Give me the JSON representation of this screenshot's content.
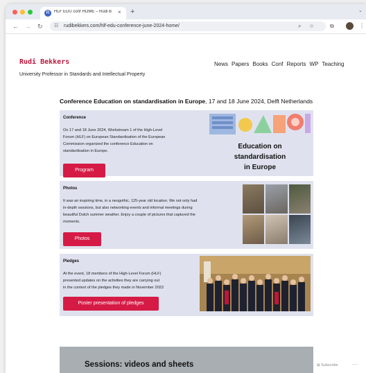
{
  "browser": {
    "tab_title": "HLF EDU conf HOME – Rudi B",
    "tab_favicon": "R",
    "tab_close": "×",
    "new_tab": "+",
    "tab_menu": "⌄",
    "url": "rudibekkers.com/hlf-edu-conference-june-2024-home/"
  },
  "site": {
    "brand": "Rudi Bekkers",
    "tagline": "University Professor in Standards and Intellectual Property",
    "nav": [
      "News",
      "Papers",
      "Books",
      "Conf",
      "Reports",
      "WP",
      "Teaching"
    ]
  },
  "main": {
    "title_bold": "Conference Education on standardisation in Europe",
    "title_rest": ", 17 and 18 June 2024, Delft Netherlands",
    "conference": {
      "heading": "Conference",
      "lines": [
        "On 17 and 18 June 2024, Workstream 1 of the High-Level",
        "Forum (HLF) on European Standardisation of the European",
        "Commission organized the conference Education on",
        "standardisation in Europe."
      ],
      "button": "Program",
      "hero_lines": [
        "Education on",
        "standardisation",
        "in Europe"
      ]
    },
    "photos": {
      "heading": "Photos",
      "lines": [
        "It was an inspiring time, in a neogothic, 125-year old location. We not only had",
        "in-depth sessions, but also networking events and informal meetings during",
        "beautiful Dutch summer weather. Enjoy a couple of pictures that captured the",
        "moments."
      ],
      "button": "Photos"
    },
    "pledges": {
      "heading": "Pledges",
      "lines": [
        "At the event, 18 members of the High-Level Forum (HLF)",
        "presented updates on the activities they are carrying out",
        "in the context of the pledges they made in November 2023"
      ],
      "button": "Poster presentation of pledges"
    },
    "sessions_title": "Sessions: videos and sheets"
  },
  "footer": {
    "subscribe": "Subscribe",
    "more": "···"
  },
  "colors": {
    "brand": "#c0163c",
    "button": "#d61a46",
    "card": "#dfe2ee"
  }
}
